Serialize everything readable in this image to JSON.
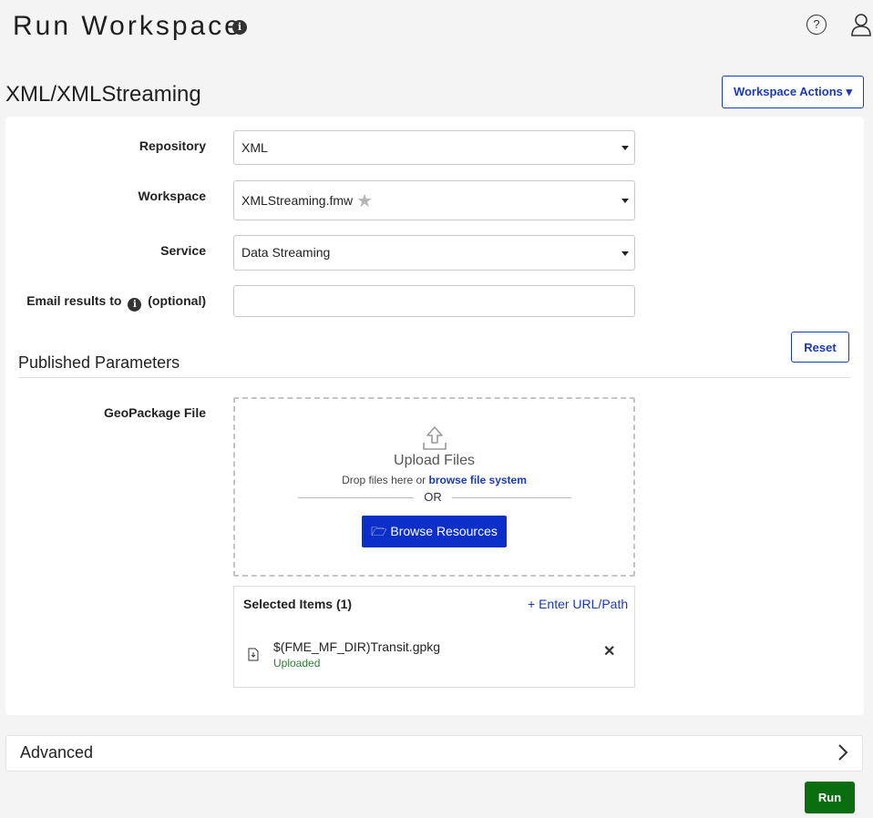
{
  "header": {
    "title": "Run Workspace",
    "info_glyph": "i",
    "help_glyph": "?"
  },
  "workspace_heading": "XML/XMLStreaming",
  "workspace_actions_label": "Workspace Actions ▾",
  "form": {
    "repository": {
      "label": "Repository",
      "value": "XML"
    },
    "workspace": {
      "label": "Workspace",
      "value": "XMLStreaming.fmw",
      "star_glyph": "★"
    },
    "service": {
      "label": "Service",
      "value": "Data Streaming"
    },
    "email": {
      "label_prefix": "Email results to",
      "label_suffix": "(optional)",
      "info_glyph": "i",
      "value": "",
      "placeholder": ""
    }
  },
  "published_parameters": {
    "heading": "Published Parameters",
    "reset_label": "Reset",
    "geopackage_label": "GeoPackage File",
    "upload": {
      "title": "Upload Files",
      "drop_prefix": "Drop files here or",
      "drop_link": "browse file system",
      "or_text": "OR",
      "browse_resources_label": "🗁 Browse Resources"
    },
    "selected": {
      "title": "Selected Items (1)",
      "enter_url_label": "+ Enter URL/Path",
      "items": [
        {
          "name": "$(FME_MF_DIR)Transit.gpkg",
          "status": "Uploaded",
          "remove_glyph": "✕"
        }
      ]
    }
  },
  "advanced": {
    "label": "Advanced"
  },
  "run_label": "Run",
  "colors": {
    "accent": "#1a3ab5",
    "browse": "#0c2fc9",
    "run": "#0a6d0f",
    "uploaded": "#2e7d32"
  },
  "icons": {
    "title_info": "info-icon",
    "help": "help-circle-icon",
    "user": "user-icon",
    "upload": "upload-icon",
    "file": "file-icon",
    "remove": "close-icon",
    "chevron": "chevron-right-icon"
  }
}
